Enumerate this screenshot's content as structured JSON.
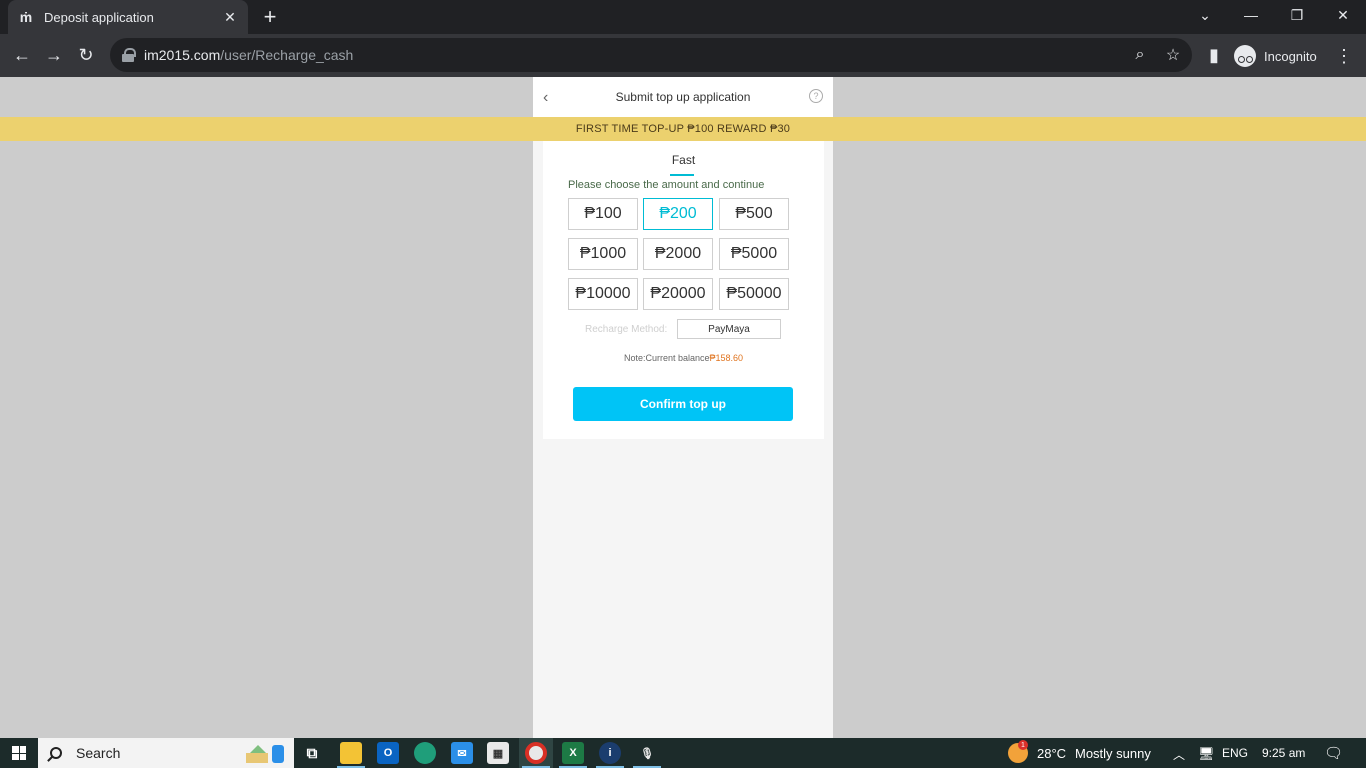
{
  "browser": {
    "tab_title": "Deposit application",
    "url_host": "im2015.com",
    "url_path": "/user/Recharge_cash",
    "incognito_label": "Incognito",
    "icons": {
      "tab_favicon": "user-icon",
      "tab_close": "close-icon",
      "new_tab": "plus-icon",
      "back": "arrow-left-icon",
      "forward": "arrow-right-icon",
      "reload": "reload-icon",
      "zoom": "zoom-icon",
      "bookmark": "star-icon",
      "side_panel": "side-panel-icon",
      "menu": "more-vert-icon"
    }
  },
  "page": {
    "header_title": "Submit top up application",
    "promo_text": "FIRST TIME TOP-UP ₱100 REWARD ₱30",
    "tab_label": "Fast",
    "instruction": "Please choose the amount and continue",
    "amounts": [
      "₱100",
      "₱200",
      "₱500",
      "₱1000",
      "₱2000",
      "₱5000",
      "₱10000",
      "₱20000",
      "₱50000"
    ],
    "selected_amount": "₱200",
    "method_label": "Recharge Method:",
    "method_value": "PayMaya",
    "note_prefix": "Note:Current balance",
    "note_balance": "₱158.60",
    "confirm_label": "Confirm top up",
    "accent_color": "#00bcd4",
    "button_color": "#00c4f6",
    "promo_color": "#ecd16e"
  },
  "taskbar": {
    "search_placeholder": "Search",
    "weather_temp": "28°C",
    "weather_desc": "Mostly sunny",
    "weather_badge": "1",
    "language": "ENG",
    "time": "9:25 am"
  }
}
